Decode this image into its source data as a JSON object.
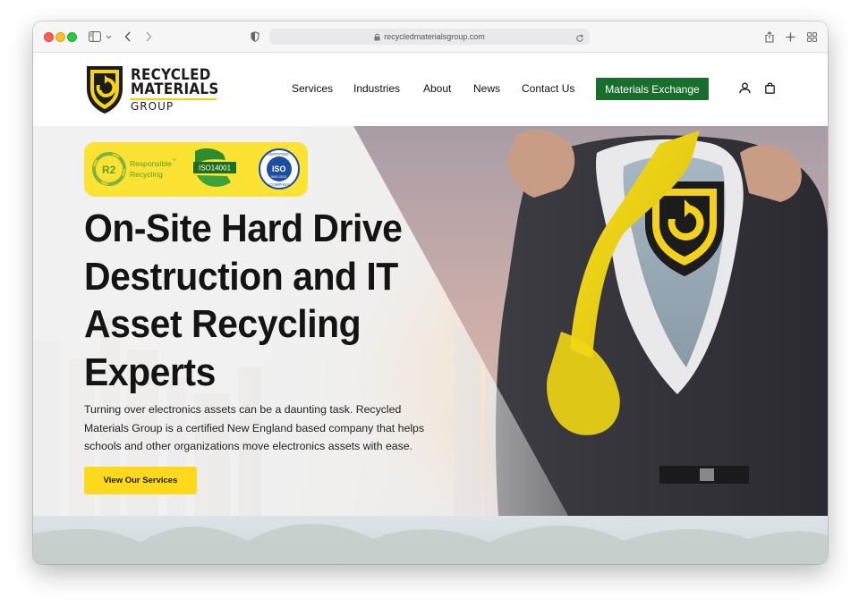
{
  "browser": {
    "url": "recycledmaterialsgroup.com",
    "icons": [
      "sidebar-icon",
      "chevron-down-icon",
      "back-icon",
      "forward-icon",
      "shield-icon",
      "lock-icon",
      "reload-icon",
      "share-icon",
      "new-tab-icon",
      "tab-overview-icon"
    ]
  },
  "site": {
    "logo": {
      "line1": "RECYCLED",
      "line2": "MATERIALS",
      "line3": "GROUP"
    },
    "menu": [
      {
        "label": "Services"
      },
      {
        "label": "Industries"
      },
      {
        "label": "About"
      },
      {
        "label": "News"
      },
      {
        "label": "Contact Us"
      }
    ],
    "cta_label": "Materials Exchange",
    "cta_color": "#1a6e2d",
    "nav_icons": [
      "account-icon",
      "bag-icon"
    ]
  },
  "hero": {
    "badges": {
      "r2_mark": "R2",
      "r2_text_1": "Responsible",
      "r2_tm": "™",
      "r2_text_2": "Recycling",
      "iso14001": "ISO14001",
      "iso_top": "CERTIFIED",
      "iso_mid": "ISO",
      "iso_num": "9001:2015",
      "iso_bottom": "COMPANY"
    },
    "headline": "On-Site Hard Drive Destruction and IT Asset Recycling Experts",
    "lead": "Turning over electronics assets can be a daunting task. Recycled Materials Group is a certified New England based company that helps schools and other organizations move electronics assets with ease.",
    "button_label": "View Our Services",
    "button_color": "#fcd91c",
    "accent_yellow": "#fbe233"
  }
}
